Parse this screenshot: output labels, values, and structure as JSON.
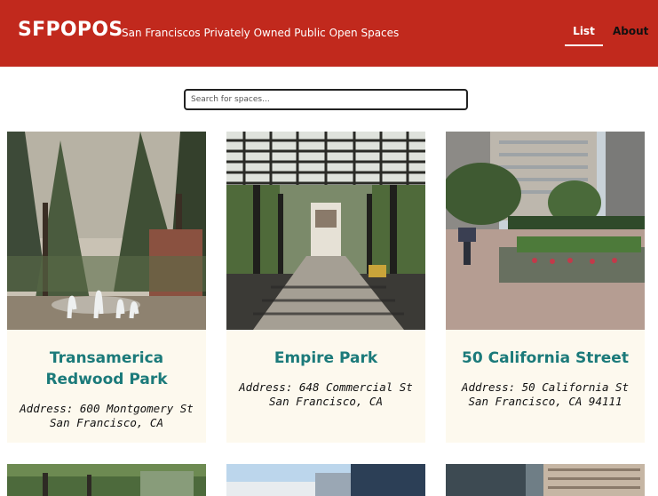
{
  "header": {
    "brand": "SFPOPOS",
    "tagline": "San Franciscos Privately Owned Public Open Spaces",
    "nav": {
      "list": "List",
      "about": "About"
    }
  },
  "search": {
    "placeholder": "Search for spaces..."
  },
  "cards": [
    {
      "title": "Transamerica Redwood Park",
      "address_line1": "Address: 600 Montgomery St",
      "address_line2": "San Francisco, CA"
    },
    {
      "title": "Empire Park",
      "address_line1": "Address: 648 Commercial St",
      "address_line2": "San Francisco, CA"
    },
    {
      "title": "50 California Street",
      "address_line1": "Address: 50 California St",
      "address_line2": "San Francisco, CA 94111"
    }
  ],
  "colors": {
    "header": "#c1291d",
    "card_bg": "#fdf9ee",
    "title": "#1b7a7a"
  }
}
